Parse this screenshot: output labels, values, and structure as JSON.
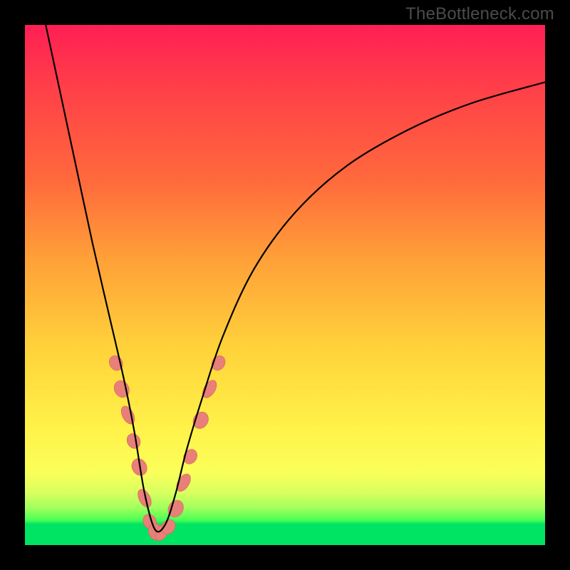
{
  "watermark": "TheBottleneck.com",
  "colors": {
    "background_black": "#000000",
    "gradient_top": "#ff1e55",
    "gradient_mid": "#ffd23a",
    "gradient_bottom": "#00e463",
    "curve_stroke": "#000000",
    "blob_fill": "#e87f78",
    "blob_stroke": "#d45f50"
  },
  "chart_data": {
    "type": "line",
    "title": "",
    "xlabel": "",
    "ylabel": "",
    "xlim": [
      0,
      100
    ],
    "ylim": [
      0,
      100
    ],
    "note": "Axes unlabeled; x/y are percent of plot area. Curve is a V-shaped dip to ~0 near x≈25.",
    "series": [
      {
        "name": "bottleneck-curve",
        "x": [
          4,
          7,
          10,
          13,
          16,
          19,
          21,
          23,
          25,
          27,
          29,
          31,
          34,
          38,
          44,
          52,
          62,
          74,
          86,
          100
        ],
        "y": [
          100,
          86,
          72,
          58,
          45,
          32,
          22,
          10,
          3,
          4,
          10,
          18,
          28,
          40,
          53,
          64,
          73,
          80,
          85,
          89
        ]
      }
    ],
    "markers": {
      "name": "highlight-blobs",
      "note": "Pink lozenge markers clustered near the valley and lower flanks.",
      "points": [
        {
          "x": 17.5,
          "y": 35
        },
        {
          "x": 18.6,
          "y": 30
        },
        {
          "x": 19.8,
          "y": 25
        },
        {
          "x": 20.9,
          "y": 20
        },
        {
          "x": 22.0,
          "y": 15
        },
        {
          "x": 23.0,
          "y": 9
        },
        {
          "x": 24.0,
          "y": 4.5
        },
        {
          "x": 25.2,
          "y": 2.5
        },
        {
          "x": 26.4,
          "y": 2.5
        },
        {
          "x": 27.6,
          "y": 3.5
        },
        {
          "x": 29.0,
          "y": 7
        },
        {
          "x": 30.5,
          "y": 12
        },
        {
          "x": 31.8,
          "y": 17
        },
        {
          "x": 33.8,
          "y": 24
        },
        {
          "x": 35.5,
          "y": 30
        },
        {
          "x": 37.2,
          "y": 35
        }
      ]
    }
  }
}
